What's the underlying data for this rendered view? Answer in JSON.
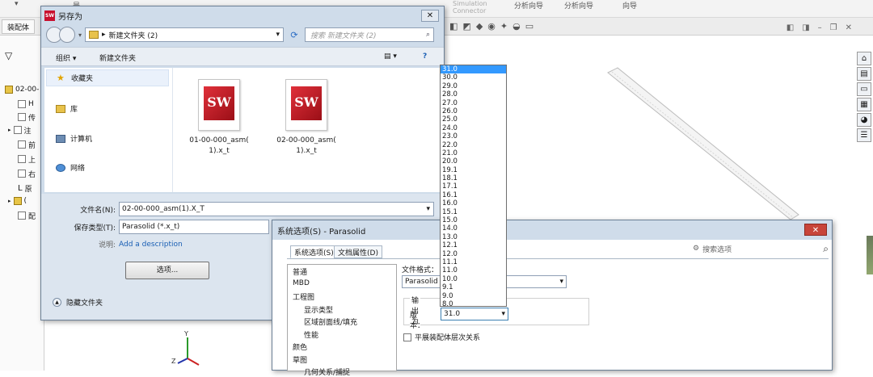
{
  "solidworks": {
    "topbar_items": [
      "▾",
      "是",
      "Simulation\nConnector",
      "分析向导",
      "分析向导",
      "向导"
    ],
    "tab": "装配体",
    "tree_items": [
      "02-00-",
      "H",
      "传",
      "注",
      "前",
      "上",
      "右",
      "原",
      "(",
      "配"
    ]
  },
  "saveas": {
    "title": "另存为",
    "close": "✕",
    "address_path": "新建文件夹 (2)",
    "search_placeholder": "搜索 新建文件夹 (2)",
    "organize": "组织 ▾",
    "new_folder": "新建文件夹",
    "nav": [
      "收藏夹",
      "库",
      "计算机",
      "网络"
    ],
    "files": [
      {
        "name": "01-00-000_asm(\n1).x_t"
      },
      {
        "name": "02-00-000_asm(\n1).x_t"
      }
    ],
    "file_name_label": "文件名(N):",
    "file_name_value": "02-00-000_asm(1).X_T",
    "save_type_label": "保存类型(T):",
    "save_type_value": "Parasolid (*.x_t)",
    "desc_label": "说明:",
    "desc_link": "Add a description",
    "options_button": "选项...",
    "hide_folders": "隐藏文件夹",
    "logo_text": "SW"
  },
  "sysopt": {
    "title": "系统选项(S) - Parasolid",
    "close": "✕",
    "tab_system": "系统选项(S)",
    "tab_doc": "文档属性(D)",
    "search_placeholder": "搜索选项",
    "list": [
      "普通",
      "MBD",
      "工程图",
      "显示类型",
      "区域剖面线/填充",
      "性能",
      "颜色",
      "草图",
      "几何关系/捕捉"
    ],
    "format_label": "文件格式：",
    "format_value": "Parasolid",
    "output_label": "输出为",
    "version_label": "版本：",
    "version_value": "31.0",
    "flat_asm": "平展装配体层次关系"
  },
  "version_options": [
    "31.0",
    "30.0",
    "29.0",
    "28.0",
    "27.0",
    "26.0",
    "25.0",
    "24.0",
    "23.0",
    "22.0",
    "21.0",
    "20.0",
    "19.1",
    "18.1",
    "17.1",
    "16.1",
    "16.0",
    "15.1",
    "15.0",
    "14.0",
    "13.0",
    "12.1",
    "12.0",
    "11.1",
    "11.0",
    "10.0",
    "9.1",
    "9.0",
    "8.0"
  ],
  "selected_version": "31.0"
}
